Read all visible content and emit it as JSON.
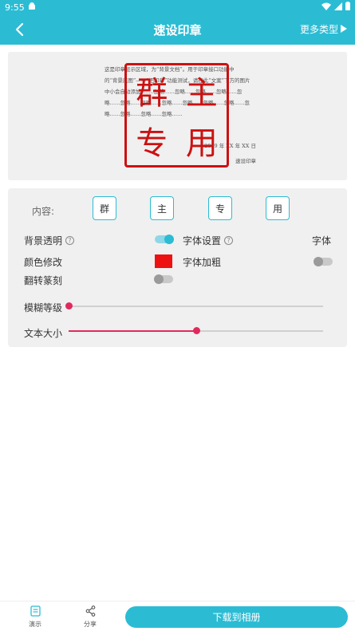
{
  "status": {
    "time": "9:55"
  },
  "header": {
    "title": "速设印章",
    "more_label": "更多类型"
  },
  "preview": {
    "doc_lines": [
      "这是印章显示区域，为“背景文档”。用于印章接口功能中",
      "的“背景底图”——“把印章”功能测试，请在此“文案”下方的图片",
      "中小会自动添加“……忽略……忽略……忽略……忽略……忽",
      "略……忽略……忽略……忽略……忽略……忽略……忽略……忽",
      "略……忽略……忽略……忽略……"
    ],
    "signature_date": "2019 年 XX 年 XX 日",
    "signature_name": "速设印章",
    "stamp_chars": [
      "群",
      "主",
      "专",
      "用"
    ],
    "stamp_color": "#cc1111"
  },
  "settings": {
    "content_label": "内容:",
    "chars": [
      "群",
      "主",
      "专",
      "用"
    ],
    "bg_transparent_label": "背景透明",
    "font_settings_label": "字体设置",
    "font_value": "字体",
    "color_modify_label": "颜色修改",
    "color_value": "#ee1111",
    "font_bold_label": "字体加粗",
    "flip_engrave_label": "翻转篆刻",
    "blur_label": "模糊等级",
    "blur_level": 0,
    "text_size_label": "文本大小",
    "text_size_level": 0.5,
    "toggles": {
      "bg_transparent": true,
      "font_bold": false,
      "flip_engrave": false
    }
  },
  "bottom": {
    "tab_demo": "演示",
    "tab_share": "分享",
    "download_label": "下载到相册"
  }
}
